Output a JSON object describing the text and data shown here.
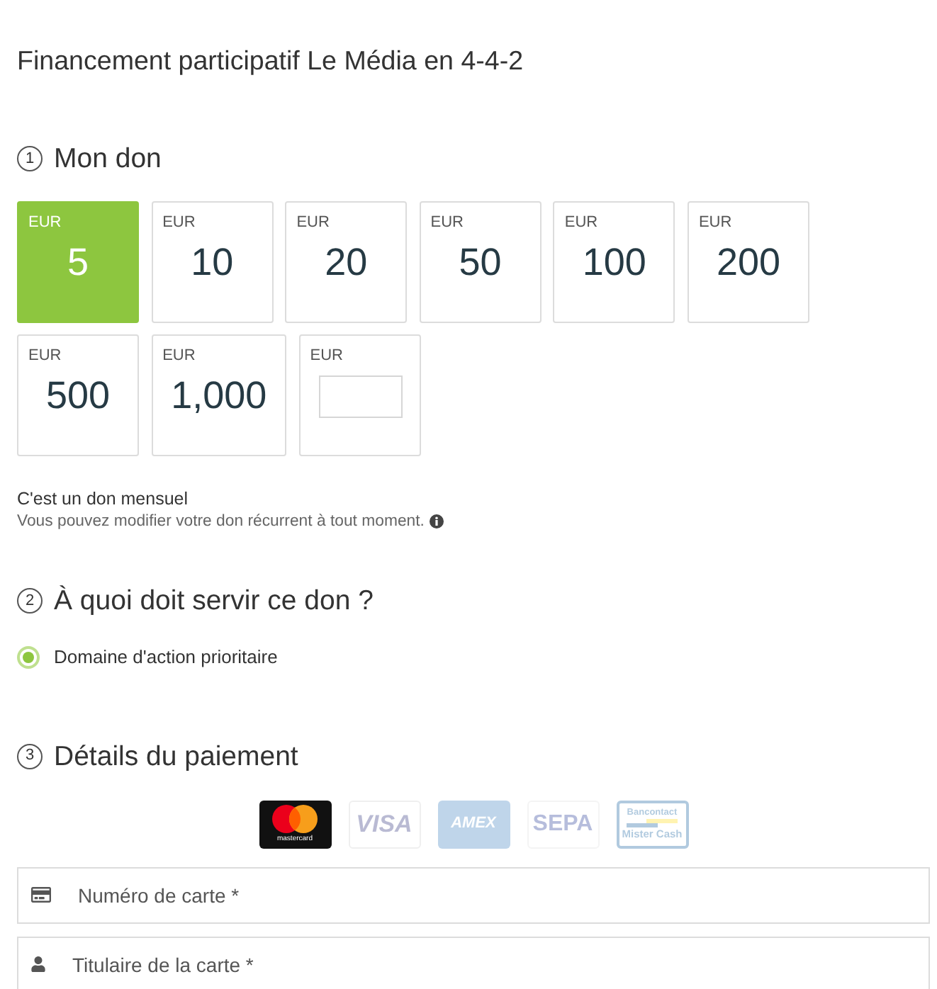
{
  "page": {
    "title": "Financement participatif Le Média en 4-4-2"
  },
  "donation": {
    "step": "1",
    "heading": "Mon don",
    "amounts": [
      {
        "kind": "preset",
        "currency": "EUR",
        "value": "5",
        "selected": true
      },
      {
        "kind": "preset",
        "currency": "EUR",
        "value": "10",
        "selected": false
      },
      {
        "kind": "preset",
        "currency": "EUR",
        "value": "20",
        "selected": false
      },
      {
        "kind": "preset",
        "currency": "EUR",
        "value": "50",
        "selected": false
      },
      {
        "kind": "preset",
        "currency": "EUR",
        "value": "100",
        "selected": false
      },
      {
        "kind": "preset",
        "currency": "EUR",
        "value": "200",
        "selected": false
      },
      {
        "kind": "preset",
        "currency": "EUR",
        "value": "500",
        "selected": false
      },
      {
        "kind": "preset",
        "currency": "EUR",
        "value": "1,000",
        "selected": false
      },
      {
        "kind": "custom",
        "currency": "EUR",
        "selected": false
      }
    ],
    "recurrence": {
      "label": "C'est un don mensuel",
      "note": "Vous pouvez modifier votre don récurrent à tout moment."
    }
  },
  "purpose": {
    "step": "2",
    "heading": "À quoi doit servir ce don ?",
    "options": [
      {
        "label": "Domaine d'action prioritaire",
        "selected": true
      }
    ]
  },
  "payment": {
    "step": "3",
    "heading": "Détails du paiement",
    "methods": [
      {
        "kind": "mastercard",
        "label": "mastercard",
        "selected": true
      },
      {
        "kind": "visa",
        "label": "VISA",
        "selected": false
      },
      {
        "kind": "amex",
        "label": "AMEX",
        "selected": false
      },
      {
        "kind": "sepa",
        "label": "SEPA",
        "selected": false
      },
      {
        "kind": "bancontact",
        "label": "Bancontact",
        "sublabel": "Mister Cash",
        "selected": false
      }
    ],
    "fields": [
      {
        "kind": "card",
        "placeholder": "Numéro de carte *"
      },
      {
        "kind": "person",
        "placeholder": "Titulaire de la carte *"
      }
    ]
  }
}
